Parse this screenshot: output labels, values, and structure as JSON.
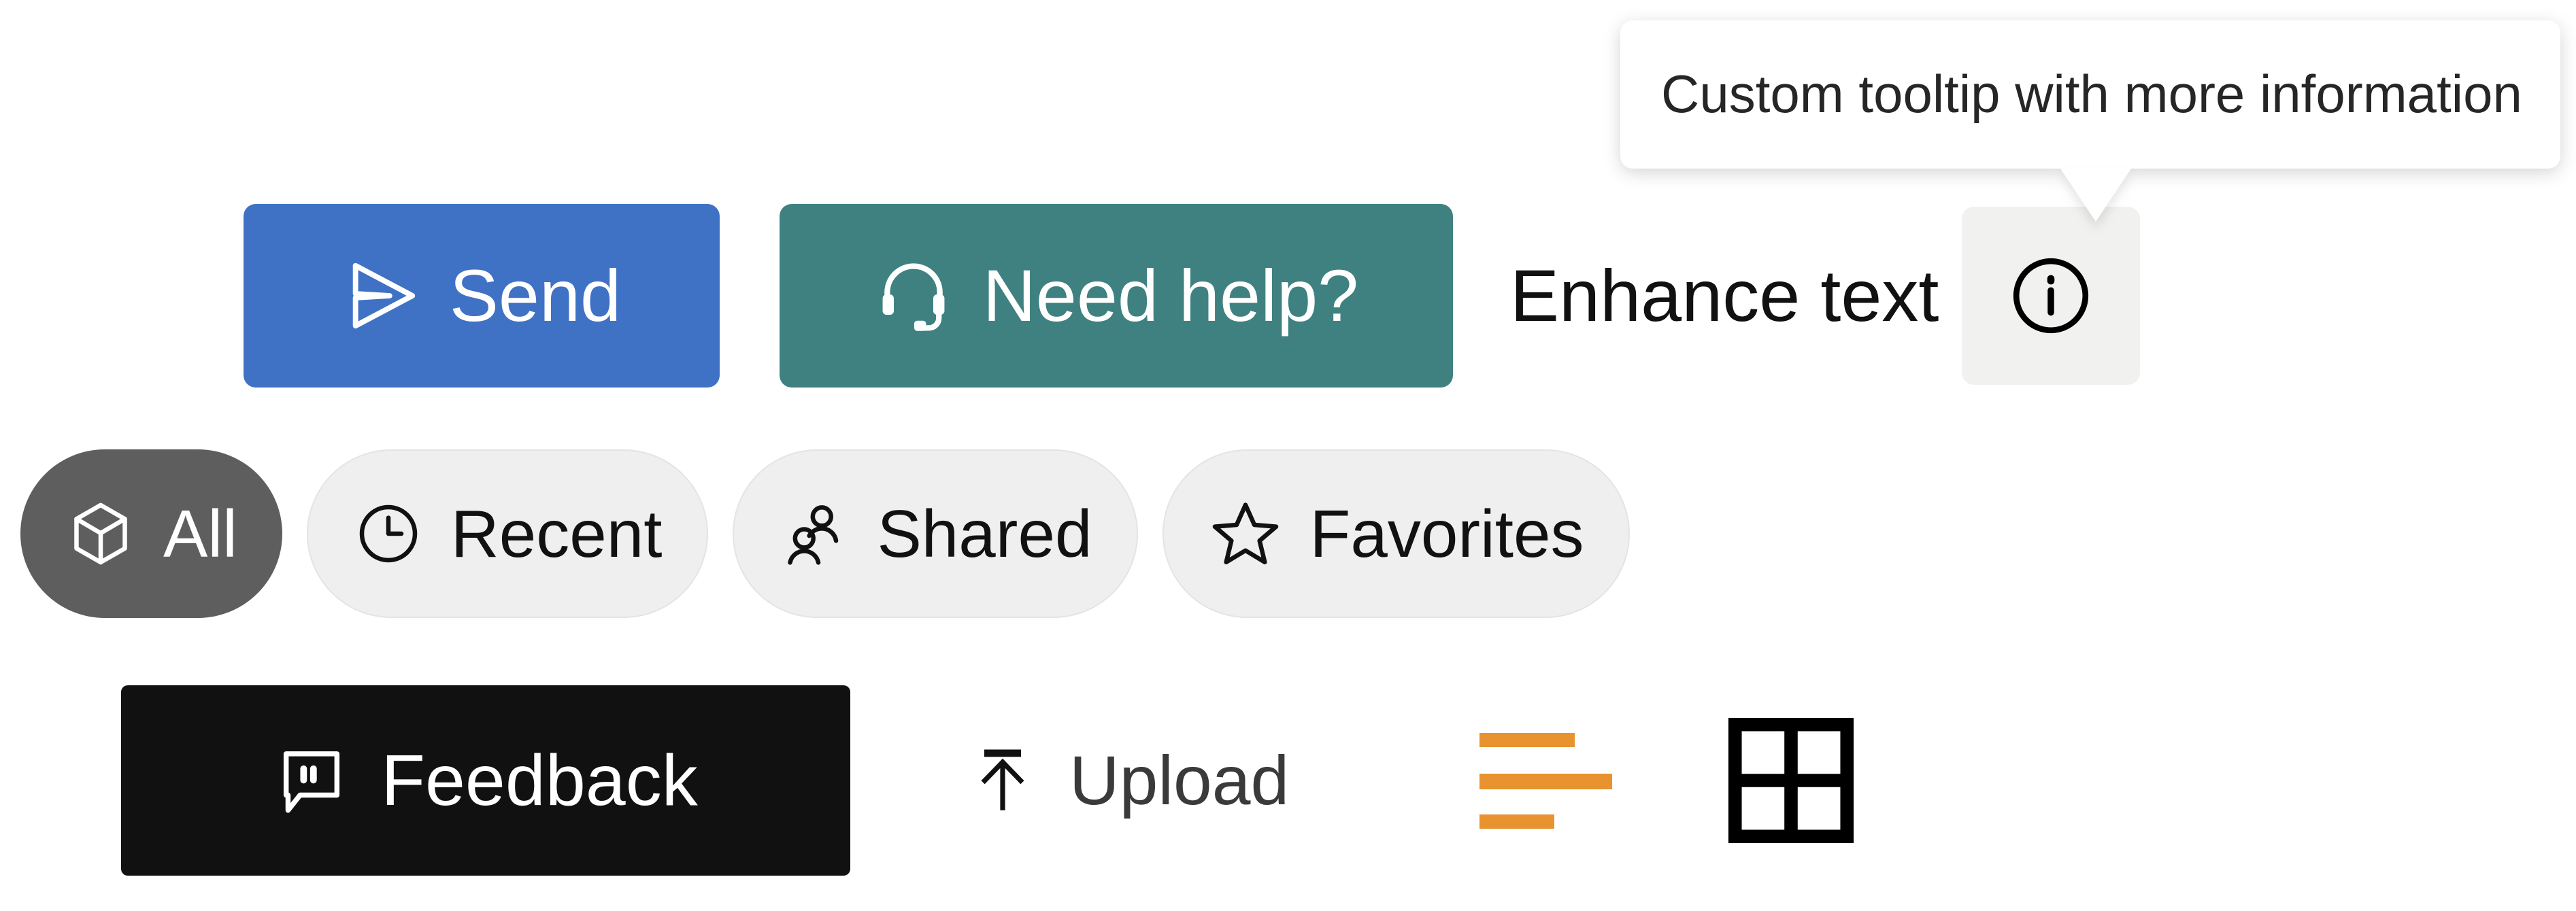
{
  "actions": {
    "send": {
      "label": "Send",
      "icon": "send-icon",
      "background": "#3f72c4",
      "text_color": "#ffffff"
    },
    "need_help": {
      "label": "Need help?",
      "icon": "headset-icon",
      "background": "#3f8181",
      "text_color": "#ffffff"
    },
    "enhance": {
      "label": "Enhance text",
      "info_icon": "info-circle-icon",
      "info_button_background": "#f1f1f0"
    }
  },
  "tooltip": {
    "text": "Custom tooltip with more information",
    "background": "#ffffff",
    "text_color": "#262626"
  },
  "filters": {
    "items": [
      {
        "label": "All",
        "icon": "cube-icon",
        "selected": true
      },
      {
        "label": "Recent",
        "icon": "clock-icon",
        "selected": false
      },
      {
        "label": "Shared",
        "icon": "people-icon",
        "selected": false
      },
      {
        "label": "Favorites",
        "icon": "star-icon",
        "selected": false
      }
    ],
    "selected_background": "#5e5e5e",
    "unselected_background": "#efefef"
  },
  "misc": {
    "feedback": {
      "label": "Feedback",
      "icon": "comment-quote-icon",
      "background": "#111111",
      "text_color": "#ffffff"
    },
    "upload": {
      "label": "Upload",
      "icon": "arrow-up-to-line-icon",
      "text_color": "#3a3a3a"
    },
    "list_view": {
      "icon": "list-lines-icon",
      "color": "#e8932f"
    },
    "grid_view": {
      "icon": "grid-2x2-icon",
      "color": "#000000"
    }
  }
}
